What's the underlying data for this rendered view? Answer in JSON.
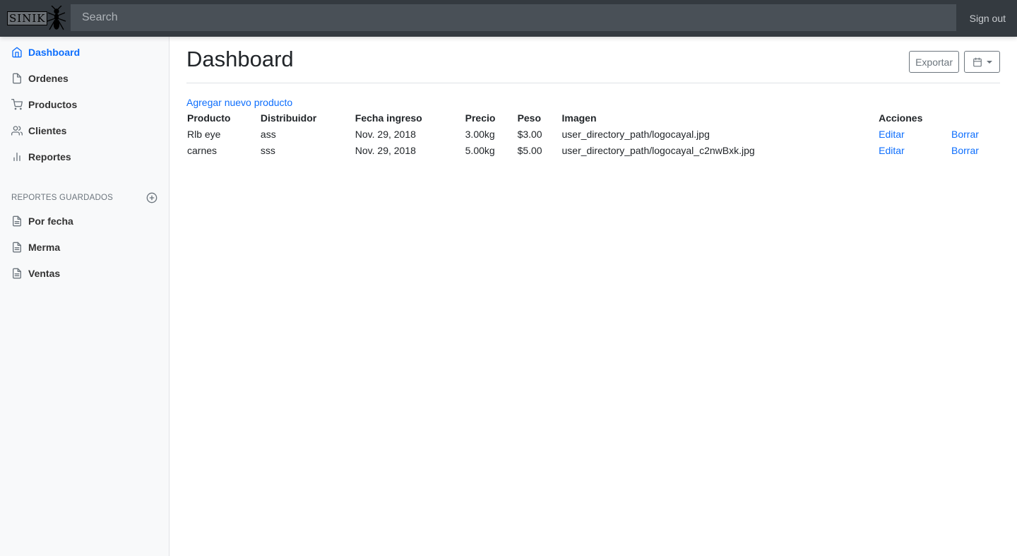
{
  "navbar": {
    "brand": "SINIK",
    "search_placeholder": "Search",
    "signout": "Sign out"
  },
  "sidebar": {
    "items": [
      {
        "label": "Dashboard",
        "icon": "home-icon"
      },
      {
        "label": "Ordenes",
        "icon": "file-icon"
      },
      {
        "label": "Productos",
        "icon": "shopping-cart-icon"
      },
      {
        "label": "Clientes",
        "icon": "users-icon"
      },
      {
        "label": "Reportes",
        "icon": "bar-chart-icon"
      }
    ],
    "saved_heading": "REPORTES GUARDADOS",
    "saved": [
      {
        "label": "Por fecha",
        "icon": "file-text-icon"
      },
      {
        "label": "Merma",
        "icon": "file-text-icon"
      },
      {
        "label": "Ventas",
        "icon": "file-text-icon"
      }
    ]
  },
  "main": {
    "title": "Dashboard",
    "export_label": "Exportar",
    "add_link": "Agregar nuevo producto",
    "table": {
      "headers": [
        "Producto",
        "Distribuidor",
        "Fecha ingreso",
        "Precio",
        "Peso",
        "Imagen",
        "Acciones",
        ""
      ],
      "rows": [
        [
          "Rlb eye",
          "ass",
          "Nov. 29, 2018",
          "3.00kg",
          "$3.00",
          "user_directory_path/logocayal.jpg",
          "Editar",
          "Borrar"
        ],
        [
          "carnes",
          "sss",
          "Nov. 29, 2018",
          "5.00kg",
          "$5.00",
          "user_directory_path/logocayal_c2nwBxk.jpg",
          "Editar",
          "Borrar"
        ]
      ]
    }
  },
  "colors": {
    "accent": "#0d6efd",
    "navbar": "#343a40",
    "sidebar": "#f8f9fa"
  }
}
